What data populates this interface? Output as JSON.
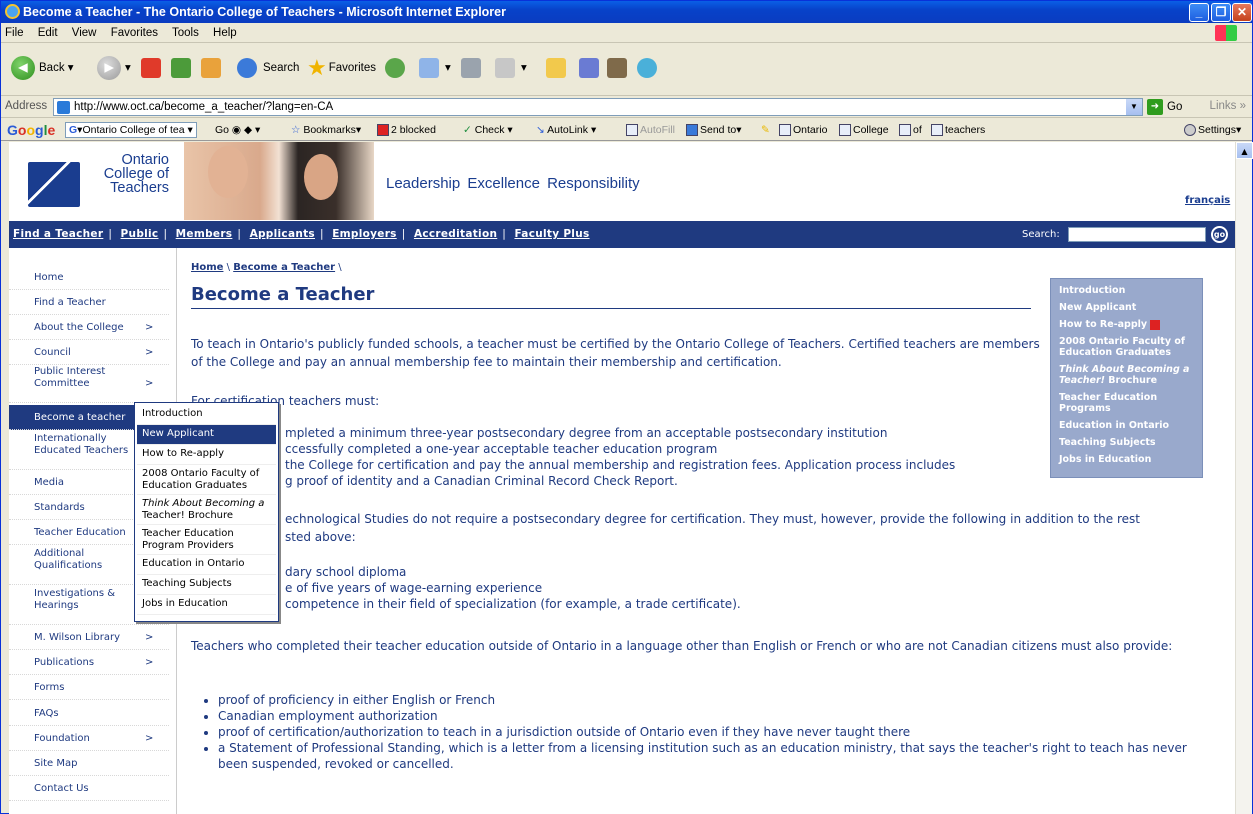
{
  "window": {
    "title": "Become a Teacher - The Ontario College of Teachers - Microsoft Internet Explorer"
  },
  "menubar": {
    "items": [
      "File",
      "Edit",
      "View",
      "Favorites",
      "Tools",
      "Help"
    ]
  },
  "toolbar": {
    "back": "Back",
    "search": "Search",
    "favorites": "Favorites"
  },
  "address": {
    "label": "Address",
    "url": "http://www.oct.ca/become_a_teacher/?lang=en-CA",
    "go": "Go",
    "links": "Links"
  },
  "googlebar": {
    "search_value": "Ontario College of tea",
    "go": "Go",
    "bookmarks": "Bookmarks",
    "blocked": "2 blocked",
    "check": "Check",
    "autolink": "AutoLink",
    "autofill": "AutoFill",
    "sendto": "Send to",
    "terms": [
      "Ontario",
      "College",
      "of",
      "teachers"
    ],
    "settings": "Settings"
  },
  "header": {
    "logo_line1": "Ontario",
    "logo_line2": "College of",
    "logo_line3": "Teachers",
    "tagline": "Leadership  Excellence  Responsibility",
    "francais": "français"
  },
  "nav": {
    "items": [
      "Find a Teacher",
      "Public",
      "Members",
      "Applicants",
      "Employers",
      "Accreditation",
      "Faculty Plus"
    ],
    "search_label": "Search:",
    "go": "go"
  },
  "sidebar": {
    "items": [
      {
        "label": "Home"
      },
      {
        "label": "Find a Teacher"
      },
      {
        "label": "About the College",
        "chev": ">"
      },
      {
        "label": "Council",
        "chev": ">"
      },
      {
        "label": "Public Interest",
        "label2": "Committee",
        "chev": ">"
      },
      {
        "label": "Become a teacher"
      },
      {
        "label": "Internationally",
        "label2": "Educated Teachers"
      },
      {
        "label": "Media"
      },
      {
        "label": "Standards"
      },
      {
        "label": "Teacher Education"
      },
      {
        "label": "Additional",
        "label2": "Qualifications"
      },
      {
        "label": "Investigations &",
        "label2": "Hearings"
      },
      {
        "label": "M. Wilson Library",
        "chev": ">"
      },
      {
        "label": "Publications",
        "chev": ">"
      },
      {
        "label": "Forms"
      },
      {
        "label": "FAQs"
      },
      {
        "label": "Foundation",
        "chev": ">"
      },
      {
        "label": "Site Map"
      },
      {
        "label": "Contact Us"
      }
    ]
  },
  "flyout": {
    "items": [
      {
        "label": "Introduction"
      },
      {
        "label": "New Applicant"
      },
      {
        "label": "How to Re-apply"
      },
      {
        "label": "2008 Ontario Faculty of",
        "label2": "Education Graduates"
      },
      {
        "label": "Think About Becoming a",
        "label2": "Teacher! Brochure"
      },
      {
        "label": "Teacher Education",
        "label2": "Program Providers"
      },
      {
        "label": "Education in Ontario"
      },
      {
        "label": "Teaching Subjects"
      },
      {
        "label": "Jobs in Education"
      }
    ]
  },
  "content": {
    "crumb_home": "Home",
    "crumb_page": "Become a Teacher",
    "title": "Become a Teacher",
    "intro": "To teach in Ontario's publicly funded schools, a teacher must be certified by the Ontario College of Teachers. Certified teachers are members of the College and pay an annual membership fee to maintain their membership and certification.",
    "for_cert": "For certification teachers must:",
    "req1": "mpleted a minimum three-year postsecondary degree from an acceptable postsecondary institution",
    "req2": "ccessfully completed a one-year acceptable teacher education program",
    "req3": "the College for certification and pay the annual membership and registration fees. Application process includes",
    "req3b": "g proof of identity and a Canadian Criminal Record Check Report.",
    "tech1": "echnological Studies do not require a postsecondary degree for certification. They must, however, provide the following in addition to the rest",
    "tech2": "sted above:",
    "tb1": "dary school diploma",
    "tb2": "e of five years of wage-earning experience",
    "tb3": "competence in their field of specialization (for example, a trade certificate).",
    "outside": "Teachers who completed their teacher education outside of Ontario in a language other than English or French or who are not Canadian citizens must also provide:",
    "ob1": "proof of proficiency in either English or French",
    "ob2": "Canadian employment authorization",
    "ob3": "proof of certification/authorization to teach in a jurisdiction outside of Ontario even if they have never taught there",
    "ob4": "a Statement of Professional Standing, which is a letter from a licensing institution such as an education ministry, that says the teacher's right to teach has never been suspended, revoked or cancelled."
  },
  "rightbox": {
    "items": [
      {
        "label": "Introduction"
      },
      {
        "label": "New Applicant"
      },
      {
        "label": "How to Re-apply"
      },
      {
        "label": "2008 Ontario Faculty of Education Graduates"
      },
      {
        "label": "Think About Becoming a Teacher!",
        "suffix": " Brochure"
      },
      {
        "label": "Teacher Education Programs"
      },
      {
        "label": "Education in Ontario"
      },
      {
        "label": "Teaching Subjects"
      },
      {
        "label": "Jobs in Education"
      }
    ]
  }
}
